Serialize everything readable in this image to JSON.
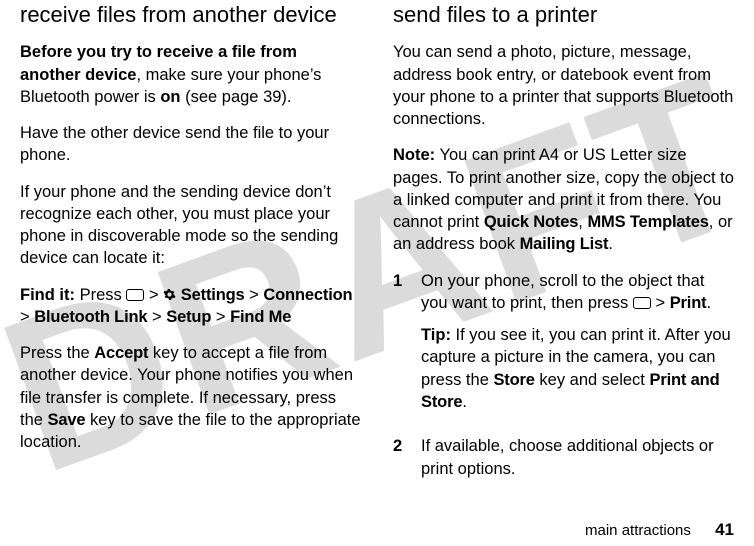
{
  "watermark": "DRAFT",
  "left": {
    "heading": "receive files from another device",
    "p1_a": "Before you try to receive a file from another device",
    "p1_b": ", make sure your phone’s Bluetooth power is ",
    "p1_c": "on",
    "p1_d": " (see page 39).",
    "p2": "Have the other device send the file to your phone.",
    "p3": "If your phone and the sending device don’t recognize each other, you must place your phone in discoverable mode so the sending device can locate it:",
    "findit_label": "Find it:",
    "findit_press": " Press ",
    "gt": ">",
    "settings": "Settings",
    "connection": "Connection",
    "bt_link": "Bluetooth Link",
    "setup": "Setup",
    "findme": "Find Me",
    "p4_a": "Press the ",
    "p4_accept": "Accept",
    "p4_b": " key to accept a file from another device. Your phone notifies you when file transfer is complete. If necessary, press the ",
    "p4_save": "Save",
    "p4_c": " key to save the file to the appropriate location."
  },
  "right": {
    "heading": "send files to a printer",
    "p1": "You can send a photo, picture, message, address book entry, or datebook event from your phone to a printer that supports Bluetooth connections.",
    "note_label": "Note:",
    "note_a": " You can print A4 or US Letter size pages. To print another size, copy the object to a linked computer and print it from there. You cannot print ",
    "quicknotes": "Quick Notes",
    "comma1": ", ",
    "mms": "MMS Templates",
    "note_b": ", or an address book ",
    "mailing": "Mailing List",
    "period": ".",
    "step1_a": "On your phone, scroll to the object that you want to print, then press ",
    "gt": ">",
    "print": "Print",
    "tip_label": "Tip:",
    "tip_a": " If you see it, you can print it. After you capture a picture in the camera, you can press the ",
    "store": "Store",
    "tip_b": " key and select ",
    "printstore": "Print and Store",
    "step2": "If available, choose additional objects or print options."
  },
  "footer": {
    "section": "main attractions",
    "page": "41"
  }
}
